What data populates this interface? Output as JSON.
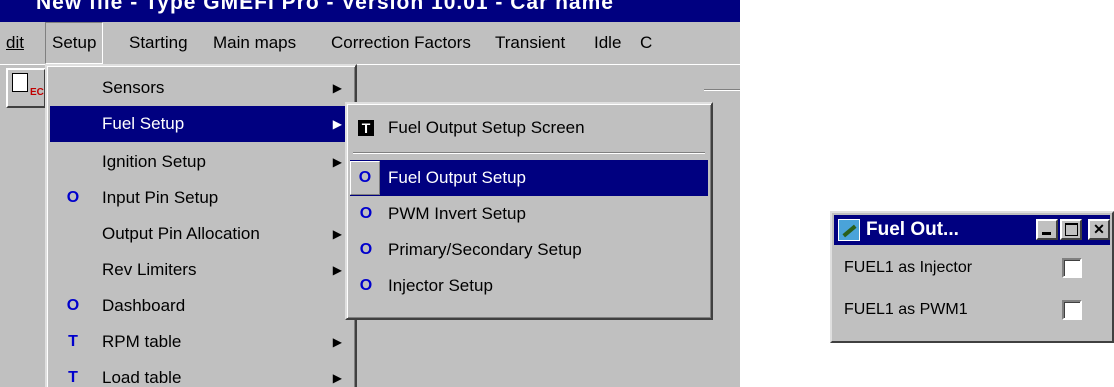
{
  "window": {
    "title": "New file - Type GMEFI Pro - Version 10.01 - Car name"
  },
  "menubar": {
    "items": [
      "dit",
      "Setup",
      "Starting",
      "Main maps",
      "Correction Factors",
      "Transient",
      "Idle",
      "C"
    ]
  },
  "toolbar": {
    "badge": "EC"
  },
  "setup_menu": {
    "items": [
      {
        "label": "Sensors",
        "marker": "",
        "submenu": true
      },
      {
        "label": "Fuel Setup",
        "marker": "",
        "submenu": true
      },
      {
        "label": "Ignition Setup",
        "marker": "",
        "submenu": true
      },
      {
        "label": "Input Pin Setup",
        "marker": "O",
        "submenu": false
      },
      {
        "label": "Output Pin Allocation",
        "marker": "",
        "submenu": true
      },
      {
        "label": "Rev Limiters",
        "marker": "",
        "submenu": true
      },
      {
        "label": "Dashboard",
        "marker": "O",
        "submenu": false
      },
      {
        "label": "RPM table",
        "marker": "T",
        "submenu": true
      },
      {
        "label": "Load table",
        "marker": "T",
        "submenu": true
      }
    ],
    "highlighted": "Fuel Setup",
    "arrow_glyph": "▶"
  },
  "fuel_submenu": {
    "items": [
      {
        "label": "Fuel Output Setup Screen",
        "marker": "T"
      },
      {
        "label": "Fuel Output Setup",
        "marker": "O"
      },
      {
        "label": "PWM Invert Setup",
        "marker": "O"
      },
      {
        "label": "Primary/Secondary Setup",
        "marker": "O"
      },
      {
        "label": "Injector Setup",
        "marker": "O"
      }
    ],
    "highlighted": "Fuel Output Setup"
  },
  "dialog": {
    "title": "Fuel Out...",
    "close_glyph": "✕",
    "rows": [
      {
        "label": "FUEL1 as Injector",
        "checked": false
      },
      {
        "label": "FUEL1 as PWM1",
        "checked": false
      }
    ]
  },
  "colors": {
    "face": "#c0c0c0",
    "highlight": "#000080",
    "marker": "#0000cc"
  }
}
